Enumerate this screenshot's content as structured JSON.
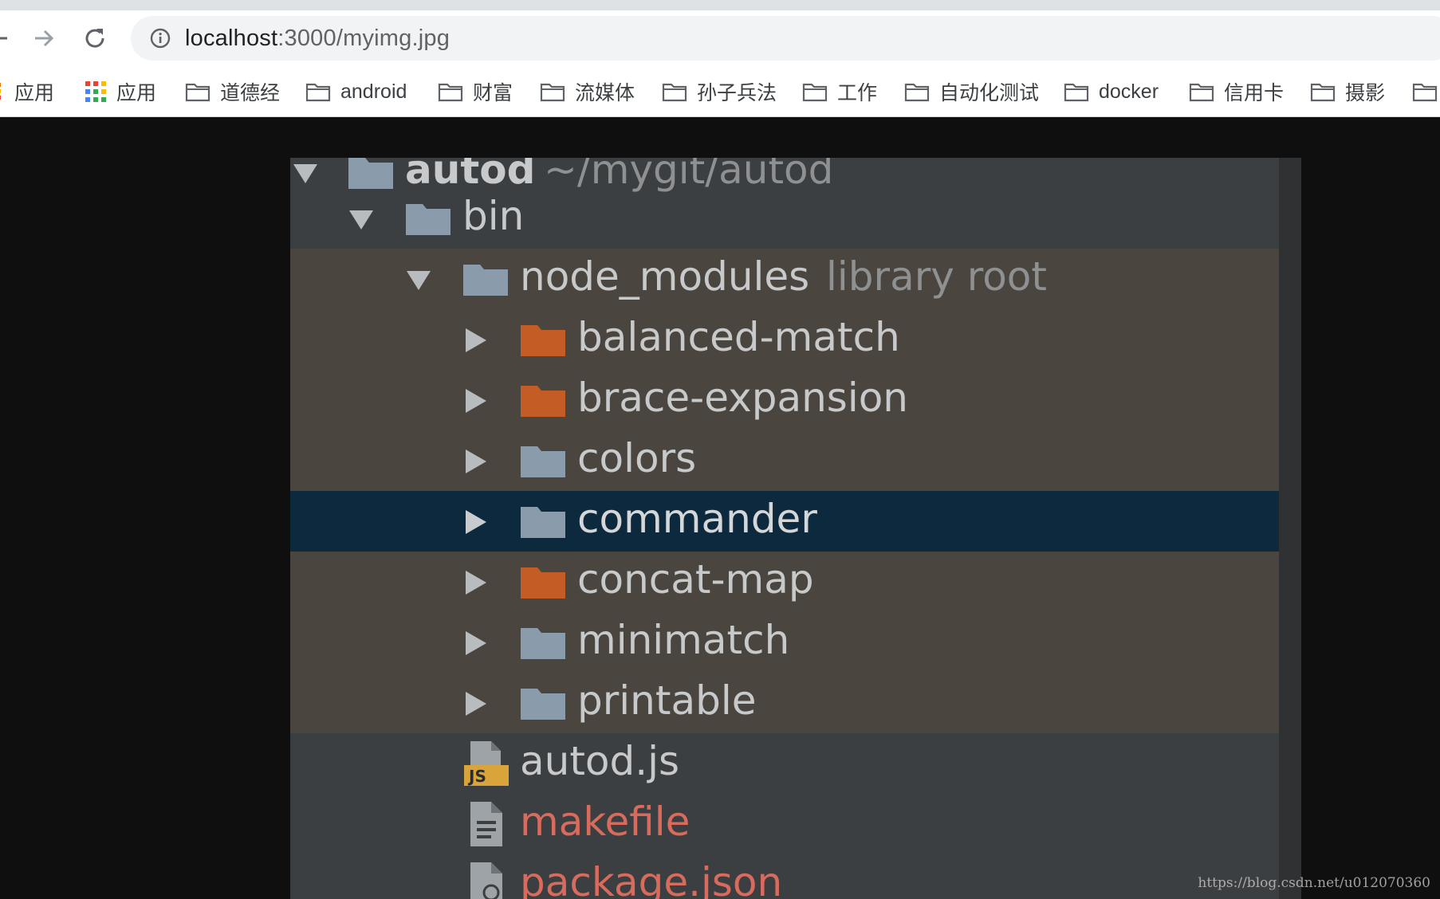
{
  "browser": {
    "url_host": "localhost",
    "url_rest": ":3000/myimg.jpg",
    "bookmarks": [
      {
        "label": "应用",
        "icon": "apps-icon"
      },
      {
        "label": "应用",
        "icon": "apps-grid-icon"
      },
      {
        "label": "道德经",
        "icon": "folder-icon"
      },
      {
        "label": "android",
        "icon": "folder-icon"
      },
      {
        "label": "财富",
        "icon": "folder-icon"
      },
      {
        "label": "流媒体",
        "icon": "folder-icon"
      },
      {
        "label": "孙子兵法",
        "icon": "folder-icon"
      },
      {
        "label": "工作",
        "icon": "folder-icon"
      },
      {
        "label": "自动化测试",
        "icon": "folder-icon"
      },
      {
        "label": "docker",
        "icon": "folder-icon"
      },
      {
        "label": "信用卡",
        "icon": "folder-icon"
      },
      {
        "label": "摄影",
        "icon": "folder-icon"
      }
    ]
  },
  "tree": {
    "root_name": "autod",
    "root_path": "~/mygit/autod",
    "bin": "bin",
    "node_modules": "node_modules",
    "library_root": "library root",
    "modules": [
      {
        "name": "balanced-match",
        "color": "#c45c26"
      },
      {
        "name": "brace-expansion",
        "color": "#c45c26"
      },
      {
        "name": "colors",
        "color": "#8a9bab"
      },
      {
        "name": "commander",
        "color": "#8a9bab"
      },
      {
        "name": "concat-map",
        "color": "#c45c26"
      },
      {
        "name": "minimatch",
        "color": "#8a9bab"
      },
      {
        "name": "printable",
        "color": "#8a9bab"
      }
    ],
    "files": [
      {
        "name": "autod.js",
        "icon": "js-file-icon"
      },
      {
        "name": "makefile",
        "icon": "text-file-icon"
      },
      {
        "name": "package.json",
        "icon": "json-file-icon"
      }
    ]
  },
  "watermark": "https://blog.csdn.net/u012070360"
}
